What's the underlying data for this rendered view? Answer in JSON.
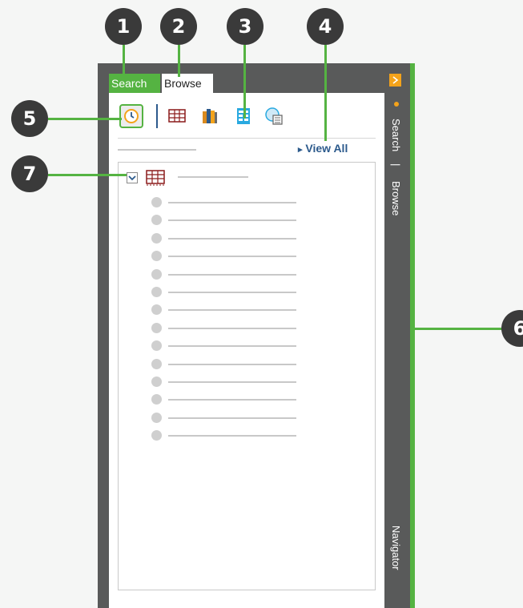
{
  "callouts": [
    "1",
    "2",
    "3",
    "4",
    "5",
    "6",
    "7"
  ],
  "tabs": {
    "search": "Search",
    "browse": "Browse"
  },
  "toolbar": {
    "icons": [
      "recent-search-icon",
      "table-icon",
      "books-icon",
      "form-icon",
      "database-icon"
    ]
  },
  "view_all": "View All",
  "side": {
    "search": "Search",
    "separator": "|",
    "browse": "Browse",
    "navigator": "Navigator"
  },
  "tree": {
    "item_count": 14
  },
  "colors": {
    "accent": "#55b342",
    "panel": "#595a5a",
    "callout": "#3a3a3a",
    "link": "#2c5a8c"
  }
}
